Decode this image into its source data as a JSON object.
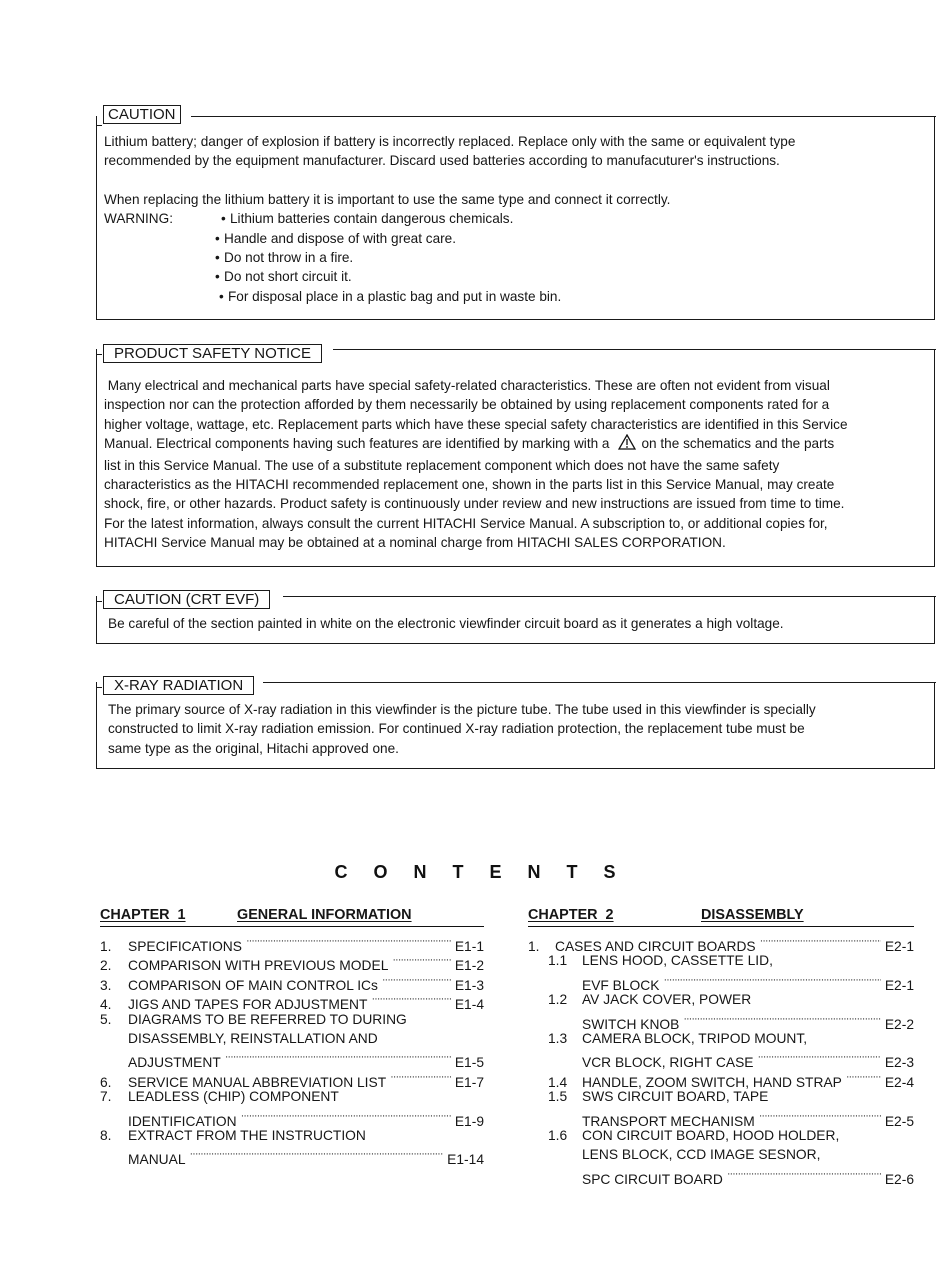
{
  "caution": {
    "title": "CAUTION",
    "paragraph1_line1": "Lithium battery; danger of explosion if battery is incorrectly replaced.  Replace only with the same or equivalent type",
    "paragraph1_line2": "recommended by the equipment manufacturer.  Discard used batteries according to manufacuturer's instructions.",
    "paragraph2": "When replacing the lithium battery it is important to use the same type and connect it correctly.",
    "warning_label": "WARNING:",
    "warnings": [
      "Lithium batteries contain dangerous chemicals.",
      "Handle and dispose of with great care.",
      "Do not throw in a fire.",
      "Do not short circuit it.",
      "For disposal place in a plastic bag and put in waste bin."
    ],
    "bullet": "•"
  },
  "product_safety": {
    "title": "PRODUCT SAFETY NOTICE",
    "lines": [
      " Many electrical and mechanical parts have special safety-related characteristics. These are often not evident from visual",
      "inspection nor can the protection afforded by them necessarily be obtained by using replacement components rated for a",
      "higher voltage, wattage, etc. Replacement parts which have these special safety characteristics are identified in this Service"
    ],
    "line4_before": "Manual. Electrical components having such features are identified by marking with a",
    "line4_icon": "warning-triangle-icon",
    "line4_after": "on the schematics and the parts",
    "lines_after": [
      "list in this Service Manual. The use of a substitute replacement component which does not have the same safety",
      "characteristics as the HITACHI recommended replacement one, shown in the parts list in this Service Manual, may create",
      "shock, fire, or other hazards. Product safety is continuously under review and new instructions are issued from time to time.",
      "For the latest information, always consult the current HITACHI Service Manual. A subscription to, or additional copies for,",
      "HITACHI Service Manual may be obtained at a nominal charge from HITACHI SALES CORPORATION."
    ]
  },
  "caution_crt": {
    "title": "CAUTION (CRT EVF)",
    "text": "Be careful of the section painted in white on the electronic viewfinder circuit board as it generates a high voltage."
  },
  "xray": {
    "title": "X-RAY RADIATION",
    "lines": [
      "The primary source of X-ray radiation in this viewfinder is the picture tube. The tube used in this viewfinder is specially",
      "constructed to limit X-ray radiation emission. For continued X-ray radiation protection, the replacement tube must be",
      "same type as the original, Hitachi approved one."
    ]
  },
  "contents": {
    "title": "CONTENTS",
    "chapter1": {
      "label": "CHAPTER  1",
      "name": "GENERAL INFORMATION",
      "entries": [
        {
          "num": "1.",
          "lines": [
            "SPECIFICATIONS"
          ],
          "page": "E1-1"
        },
        {
          "num": "2.",
          "lines": [
            "COMPARISON WITH PREVIOUS MODEL"
          ],
          "page": "E1-2"
        },
        {
          "num": "3.",
          "lines": [
            "COMPARISON OF MAIN CONTROL ICs"
          ],
          "page": "E1-3"
        },
        {
          "num": "4.",
          "lines": [
            "JIGS AND TAPES FOR ADJUSTMENT"
          ],
          "page": "E1-4"
        },
        {
          "num": "5.",
          "lines": [
            "DIAGRAMS TO BE REFERRED TO DURING",
            "DISASSEMBLY, REINSTALLATION AND",
            "ADJUSTMENT"
          ],
          "page": "E1-5"
        },
        {
          "num": "6.",
          "lines": [
            "SERVICE MANUAL ABBREVIATION LIST"
          ],
          "page": "E1-7"
        },
        {
          "num": "7.",
          "lines": [
            "LEADLESS (CHIP) COMPONENT",
            "IDENTIFICATION"
          ],
          "page": "E1-9"
        },
        {
          "num": "8.",
          "lines": [
            "EXTRACT FROM THE INSTRUCTION",
            "MANUAL"
          ],
          "page": "E1-14"
        }
      ]
    },
    "chapter2": {
      "label": "CHAPTER  2",
      "name": "DISASSEMBLY",
      "entries": [
        {
          "num": "1.",
          "level": 0,
          "lines": [
            "CASES AND CIRCUIT BOARDS"
          ],
          "page": "E2-1"
        },
        {
          "num": "1.1",
          "level": 1,
          "lines": [
            "LENS HOOD, CASSETTE LID,",
            "EVF BLOCK"
          ],
          "page": "E2-1"
        },
        {
          "num": "1.2",
          "level": 1,
          "lines": [
            "AV JACK COVER, POWER",
            "SWITCH KNOB"
          ],
          "page": "E2-2"
        },
        {
          "num": "1.3",
          "level": 1,
          "lines": [
            "CAMERA BLOCK, TRIPOD MOUNT,",
            "VCR BLOCK, RIGHT CASE"
          ],
          "page": "E2-3"
        },
        {
          "num": "1.4",
          "level": 1,
          "lines": [
            "HANDLE, ZOOM SWITCH, HAND STRAP"
          ],
          "page": "E2-4"
        },
        {
          "num": "1.5",
          "level": 1,
          "lines": [
            "SWS CIRCUIT BOARD, TAPE",
            "TRANSPORT MECHANISM"
          ],
          "page": "E2-5"
        },
        {
          "num": "1.6",
          "level": 1,
          "lines": [
            "CON CIRCUIT BOARD, HOOD HOLDER,",
            "LENS BLOCK, CCD IMAGE SESNOR,",
            "SPC CIRCUIT BOARD"
          ],
          "page": "E2-6"
        }
      ]
    }
  }
}
